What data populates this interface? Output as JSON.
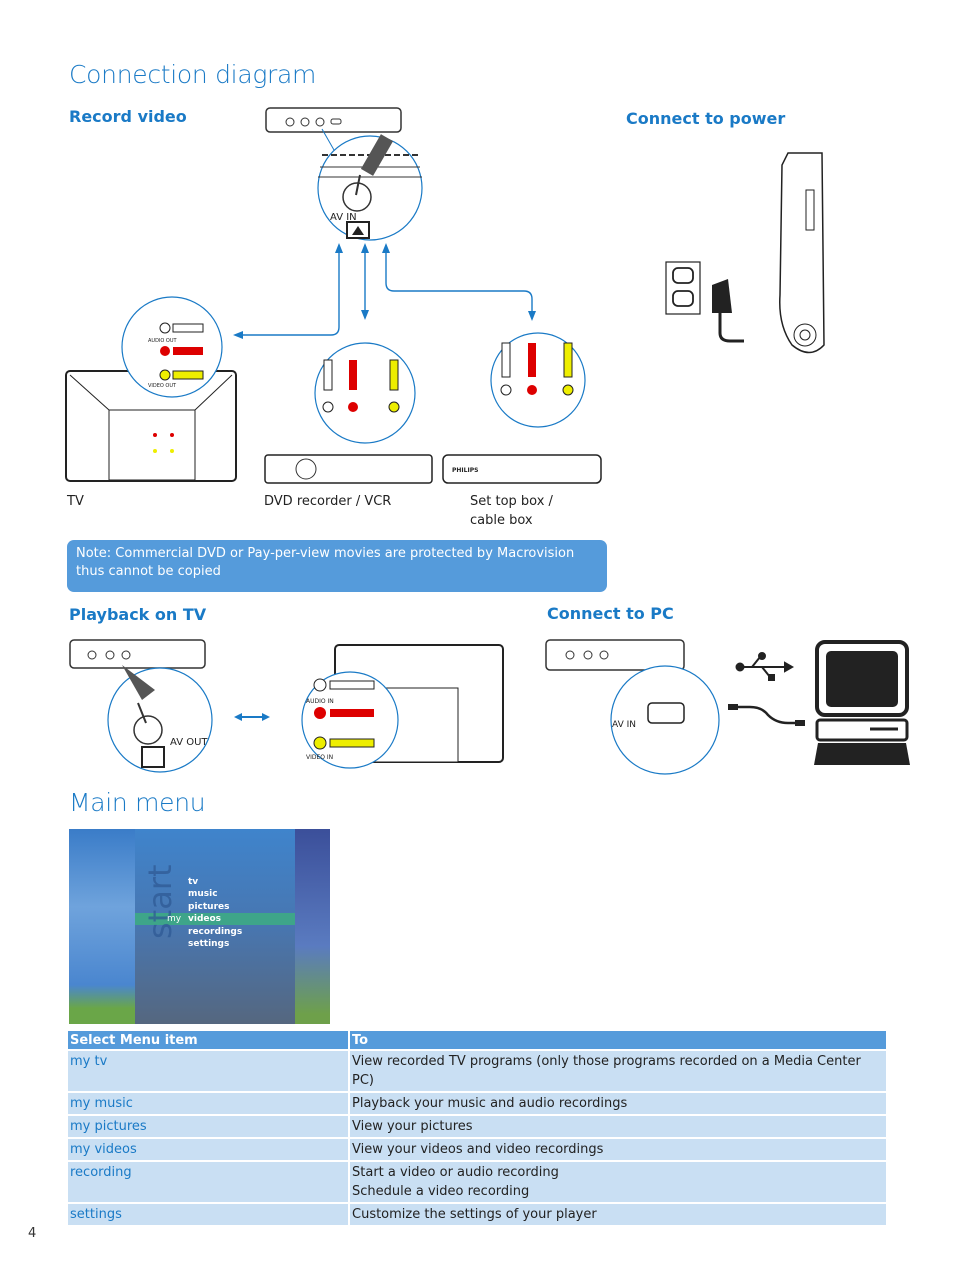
{
  "page": {
    "title": "Connection diagram",
    "page_number": "4",
    "accent_color": "#1a7ac6",
    "note_color": "#559bdb"
  },
  "sections": {
    "record_video": "Record video",
    "connect_power": "Connect to power",
    "playback_tv": "Playback on TV",
    "connect_pc": "Connect to PC"
  },
  "diagram_labels": {
    "av_in": "AV IN",
    "av_out": "AV OUT",
    "audio_out": "AUDIO OUT",
    "video_out": "VIDEO OUT",
    "audio_in": "AUDIO IN",
    "video_in": "VIDEO IN",
    "philips": "PHILIPS"
  },
  "devices": {
    "tv": "TV",
    "dvd": "DVD recorder / VCR",
    "stb_line1": "Set top box /",
    "stb_line2": "cable box"
  },
  "note": {
    "line1": "Note: Commercial DVD or Pay-per-view movies are protected by Macrovision",
    "line2": "thus cannot be copied"
  },
  "main_menu": {
    "title": "Main menu",
    "screen": {
      "start_label": "start",
      "my_label": "my",
      "items": [
        "tv",
        "music",
        "pictures",
        "videos",
        "recordings",
        "settings"
      ],
      "selected": "videos"
    },
    "table": {
      "headers": [
        "Select Menu item",
        "To"
      ],
      "rows": [
        {
          "item": "my tv",
          "desc": [
            "View recorded TV programs (only those programs recorded on a Media Center PC)"
          ]
        },
        {
          "item": "my music",
          "desc": [
            "Playback your music and audio recordings"
          ]
        },
        {
          "item": "my pictures",
          "desc": [
            "View your pictures"
          ]
        },
        {
          "item": "my videos",
          "desc": [
            "View your videos and video recordings"
          ]
        },
        {
          "item": "recording",
          "desc": [
            "Start a video or audio recording",
            "Schedule a video recording"
          ]
        },
        {
          "item": "settings",
          "desc": [
            "Customize the settings of your player"
          ]
        }
      ]
    }
  }
}
